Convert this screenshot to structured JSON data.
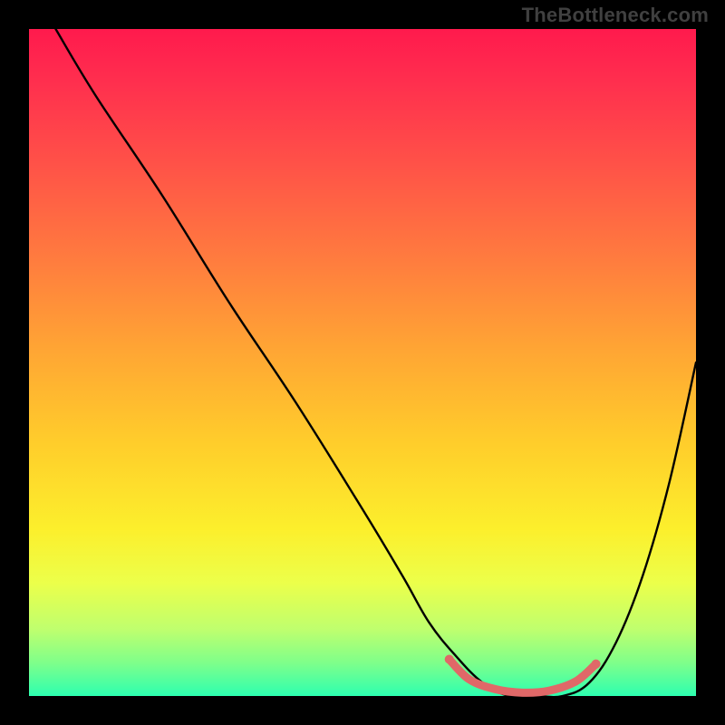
{
  "watermark": "TheBottleneck.com",
  "chart_data": {
    "type": "line",
    "title": "",
    "xlabel": "",
    "ylabel": "",
    "xlim": [
      0,
      100
    ],
    "ylim": [
      0,
      100
    ],
    "gradient_stops": [
      {
        "pos": 0,
        "color": "#ff1a4d"
      },
      {
        "pos": 8,
        "color": "#ff2f4e"
      },
      {
        "pos": 20,
        "color": "#ff5148"
      },
      {
        "pos": 34,
        "color": "#ff7a3f"
      },
      {
        "pos": 48,
        "color": "#ffa534"
      },
      {
        "pos": 62,
        "color": "#ffcd2b"
      },
      {
        "pos": 75,
        "color": "#fcef2c"
      },
      {
        "pos": 83,
        "color": "#ecff4a"
      },
      {
        "pos": 90,
        "color": "#bfff6e"
      },
      {
        "pos": 95,
        "color": "#7fff8a"
      },
      {
        "pos": 100,
        "color": "#2dffb0"
      }
    ],
    "series": [
      {
        "name": "bottleneck-curve",
        "color": "#000000",
        "x": [
          4,
          10,
          20,
          30,
          40,
          50,
          56,
          60,
          64,
          68,
          72,
          76,
          80,
          84,
          88,
          92,
          96,
          100
        ],
        "y_percent": [
          100,
          90,
          75,
          59,
          44,
          28,
          18,
          11,
          6,
          2,
          0,
          0,
          0,
          2,
          8,
          18,
          32,
          50
        ]
      },
      {
        "name": "highlight-segment",
        "color": "#e06868",
        "x": [
          63,
          66,
          70,
          74,
          78,
          82,
          85
        ],
        "y_percent": [
          5.5,
          2.5,
          1.0,
          0.5,
          0.8,
          2.2,
          4.8
        ]
      }
    ],
    "highlight_endpoints": {
      "color": "#e06868",
      "radius_px": 5,
      "points": [
        {
          "x": 63,
          "y_percent": 5.5
        },
        {
          "x": 85,
          "y_percent": 4.8
        }
      ]
    }
  }
}
